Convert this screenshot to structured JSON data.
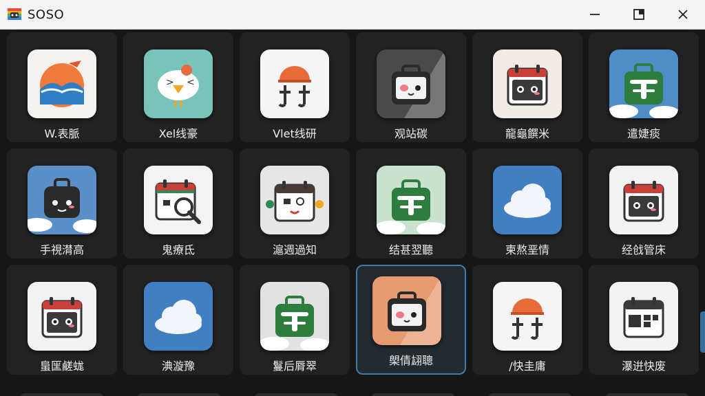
{
  "window": {
    "title": "SOSO",
    "controls": [
      "minimize-icon",
      "maximize-icon",
      "close-icon"
    ]
  },
  "apps": [
    {
      "label": "W.表脈",
      "icon": "sunset-wave-icon",
      "bg": "#f4f2ee"
    },
    {
      "label": "Xel线豪",
      "icon": "bird-icon",
      "bg": "#78c4ba"
    },
    {
      "label": "Vlet线研",
      "icon": "helmet-face-icon",
      "bg": "#f5f5f5"
    },
    {
      "label": "观站碳",
      "icon": "bag-face-icon",
      "bg": "#4a4a4a"
    },
    {
      "label": "龍龜饌米",
      "icon": "calendar-face-icon",
      "bg": "#f1ede6"
    },
    {
      "label": "遣婕痰",
      "icon": "green-bag-icon",
      "bg": "#4f8dc9"
    },
    {
      "label": "手視潸高",
      "icon": "robot-sky-icon",
      "bg": "#5a8fc8"
    },
    {
      "label": "鬼療氐",
      "icon": "calendar-search-icon",
      "bg": "#f3f3f3"
    },
    {
      "label": "滬週過知",
      "icon": "calendar-mascot-icon",
      "bg": "#e6e6e6"
    },
    {
      "label": "结甚翌聽",
      "icon": "green-bag-icon",
      "bg": "#c9e2cf"
    },
    {
      "label": "柬熬垩情",
      "icon": "cloud-icon",
      "bg": "#3f7fc2"
    },
    {
      "label": "经戗管床",
      "icon": "calendar-face-icon",
      "bg": "#f2f2f2"
    },
    {
      "label": "蛗匩鹺蛖",
      "icon": "calendar-face-icon",
      "bg": "#f2f2f2"
    },
    {
      "label": "淟漩豫",
      "icon": "cloud-icon",
      "bg": "#3f7fc2"
    },
    {
      "label": "鬘后脣翠",
      "icon": "green-bag-icon",
      "bg": "#e2e2e2"
    },
    {
      "label": "㮾倩翃聰",
      "icon": "bag-face-icon",
      "bg": "#e79a72",
      "selected": true
    },
    {
      "label": "/快圭庸",
      "icon": "helmet-face-icon",
      "bg": "#f5f5f5"
    },
    {
      "label": "瀑逬快废",
      "icon": "calendar-grid-icon",
      "bg": "#f2f2f2"
    }
  ],
  "colors": {
    "selection_border": "#3d7eb0",
    "tile_bg": "#222222",
    "window_bg": "#161616",
    "titlebar_bg": "#f3f3f3"
  }
}
